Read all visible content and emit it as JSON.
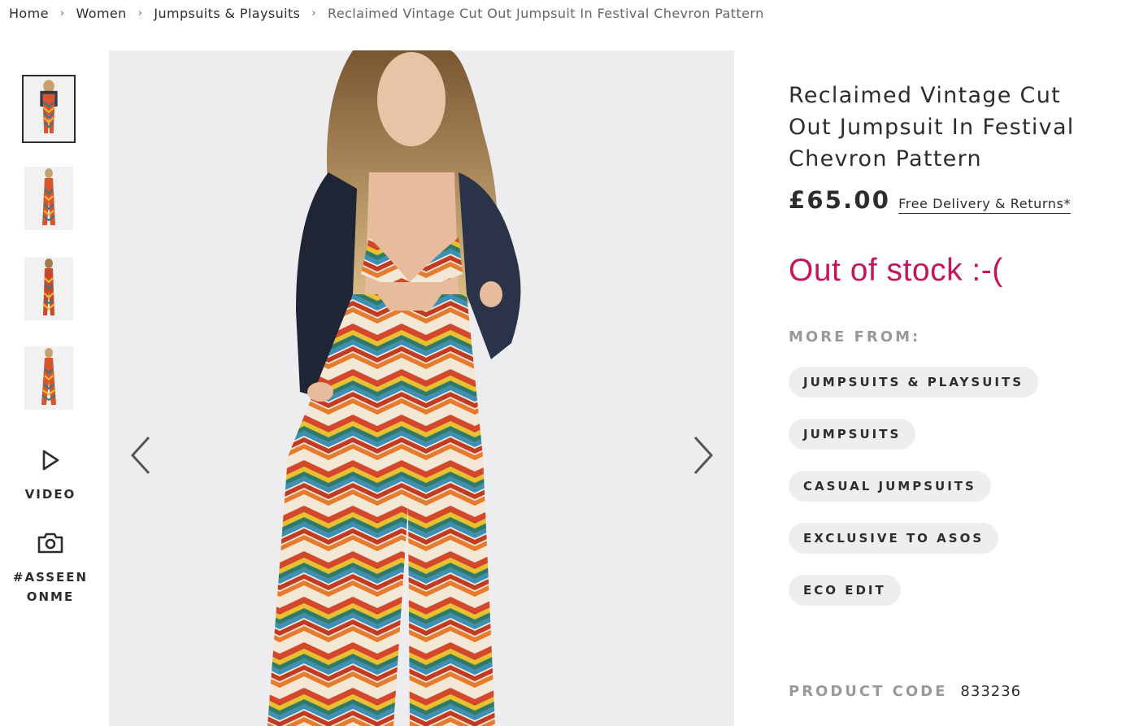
{
  "breadcrumb": {
    "items": [
      "Home",
      "Women",
      "Jumpsuits & Playsuits"
    ],
    "current": "Reclaimed Vintage Cut Out Jumpsuit In Festival Chevron Pattern",
    "separator": "›"
  },
  "gallery": {
    "thumbnail_count": 4,
    "active_index": 0,
    "video_label": "VIDEO",
    "asseen_label": "#ASSEENONME"
  },
  "product": {
    "title": "Reclaimed Vintage Cut Out Jumpsuit In Festival Chevron Pattern",
    "price": "£65.00",
    "delivery_link": "Free Delivery & Returns*",
    "stock_status": "Out of stock :-(",
    "more_from_label": "MORE FROM:",
    "tags": [
      "JUMPSUITS & PLAYSUITS",
      "JUMPSUITS",
      "CASUAL JUMPSUITS",
      "EXCLUSIVE TO ASOS",
      "ECO EDIT"
    ],
    "product_code_label": "PRODUCT CODE",
    "product_code": "833236"
  },
  "colors": {
    "stock_status": "#c2185b",
    "muted_label": "#999999",
    "tag_background": "#eeeeee",
    "image_background": "#ededf0"
  },
  "icons": {
    "video": "play-triangle-icon",
    "asseen": "camera-icon",
    "prev": "chevron-left-icon",
    "next": "chevron-right-icon"
  }
}
